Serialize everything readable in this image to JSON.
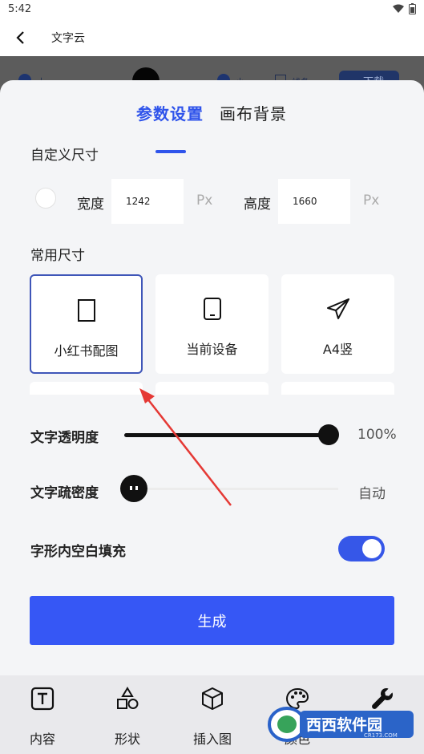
{
  "status_bar": {
    "time": "5:42"
  },
  "app_bar": {
    "title": "文字云"
  },
  "background": {
    "left_label": "大",
    "middle_label": "小",
    "box_label": "线条",
    "button_label": "下载"
  },
  "tabs": [
    {
      "label": "参数设置",
      "active": true
    },
    {
      "label": "画布背景",
      "active": false
    }
  ],
  "custom_size": {
    "section_label": "自定义尺寸",
    "width_label": "宽度",
    "width_value": "1242",
    "height_label": "高度",
    "height_value": "1660",
    "unit": "Px"
  },
  "common_size": {
    "section_label": "常用尺寸",
    "cards": [
      {
        "label": "小红书配图",
        "icon": "portrait-rect-icon",
        "selected": true
      },
      {
        "label": "当前设备",
        "icon": "phone-icon",
        "selected": false
      },
      {
        "label": "A4竖",
        "icon": "paper-plane-icon",
        "selected": false
      }
    ]
  },
  "opacity": {
    "label": "文字透明度",
    "value_text": "100%",
    "value": 1.0
  },
  "density": {
    "label": "文字疏密度",
    "value_text": "自动",
    "value": 0.0
  },
  "glyph_fill": {
    "label": "字形内空白填充",
    "enabled": true
  },
  "generate_button": {
    "label": "生成"
  },
  "bottom_nav": [
    {
      "label": "内容",
      "icon": "text-t-icon"
    },
    {
      "label": "形状",
      "icon": "shapes-icon"
    },
    {
      "label": "插入图",
      "icon": "cube-icon"
    },
    {
      "label": "颜色",
      "icon": "palette-icon"
    },
    {
      "label": "",
      "icon": "wrench-icon"
    }
  ],
  "watermark": {
    "text": "西西软件园",
    "url": "CR173.COM"
  },
  "colors": {
    "accent": "#2f54eb",
    "button": "#3657f5",
    "annotation_arrow": "#e53935"
  }
}
